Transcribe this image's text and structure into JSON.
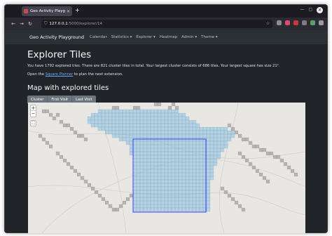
{
  "browser": {
    "tab_title": "Geo Activity Playground",
    "url_host": "127.0.0.1",
    "url_path": ":5000/explorer/14",
    "new_tab": "+",
    "back": "←",
    "forward": "→",
    "reload": "↻"
  },
  "app": {
    "brand": "Geo Activity Playground",
    "menu": [
      "Calendar",
      "Statistics ▾",
      "Explorer ▾",
      "Heatmap",
      "Admin ▾",
      "Theme ▾"
    ]
  },
  "main": {
    "title": "Explorer Tiles",
    "summary": "You have 1792 explored tiles. There are 821 cluster tiles in total. Your largest cluster consists of 686 tiles. Your largest square has size 21².",
    "planner_prefix": "Open the ",
    "planner_link": "Square Planner",
    "planner_suffix": " to plan the next extension.",
    "map_heading": "Map with explored tiles",
    "buttons": [
      "Cluster",
      "First Visit",
      "Last Visit"
    ]
  },
  "map": {
    "zoom_in": "+",
    "zoom_out": "−",
    "fullscreen": "⛶",
    "colors": {
      "cluster": "#8ec5e8",
      "explored": "#8a8a8a",
      "square": "#3a3aff",
      "land": "#e9e7e4"
    }
  }
}
